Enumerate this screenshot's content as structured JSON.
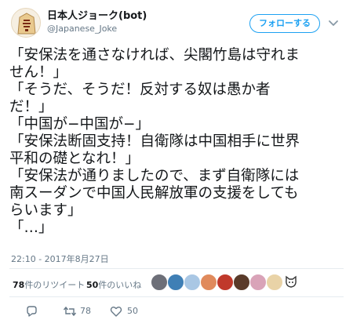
{
  "account": {
    "display_name": "日本人ジョーク(bot)",
    "screen_name": "@Japanese_Joke",
    "follow_label": "フォローする"
  },
  "tweet": {
    "lines": [
      "「安保法を通さなければ、尖閣竹島は守れま",
      "せん！」",
      "「そうだ、そうだ！反対する奴は愚か者",
      "だ！」",
      "「中国が−中国が−」",
      "「安保法断固支持！自衛隊は中国相手に世界",
      "平和の礎となれ！」",
      "「安保法が通りましたので、まず自衛隊には",
      "南スーダンで中国人民解放軍の支援をしても",
      "らいます」",
      "「…」"
    ],
    "timestamp": "22:10 - 2017年8月27日"
  },
  "stats": {
    "retweets_count": "78",
    "retweets_label": "件のリツイート",
    "likes_count": "50",
    "likes_label": "件のいいね"
  },
  "actions": {
    "retweet_count": "78",
    "like_count": "50"
  },
  "colors": {
    "accent": "#1da1f2",
    "muted": "#657786",
    "divider": "#e6ecf0"
  },
  "icons": {
    "chevron": "chevron-down-icon",
    "reply": "reply-icon",
    "retweet": "retweet-icon",
    "like": "heart-icon"
  }
}
